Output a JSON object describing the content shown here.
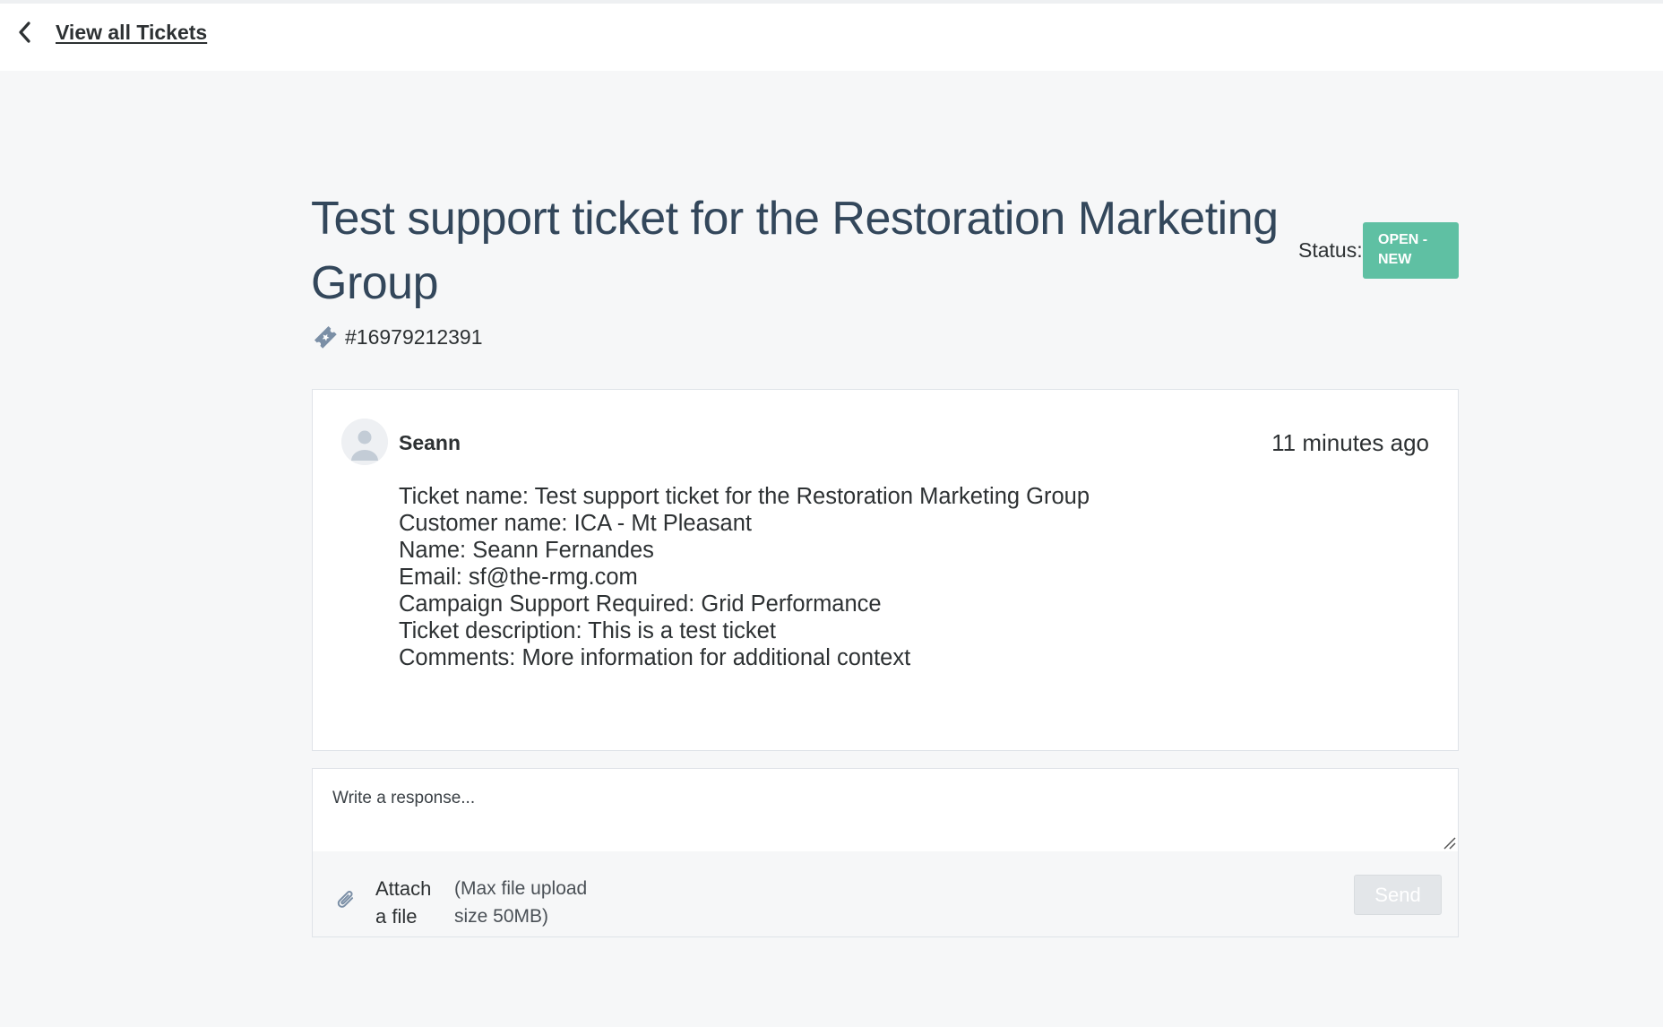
{
  "nav": {
    "back_label": "View all Tickets",
    "back_icon": "chevron-left-icon"
  },
  "ticket": {
    "title": "Test support ticket for the Restoration Marketing Group",
    "id": "#16979212391",
    "id_icon": "ticket-icon",
    "status_label": "Status:",
    "status_value": "OPEN - NEW",
    "status_color": "#5fc0a3"
  },
  "message": {
    "author": "Seann",
    "timestamp": "11 minutes ago",
    "avatar_icon": "user-avatar-icon",
    "lines": [
      "Ticket name: Test support ticket for the Restoration Marketing Group",
      "Customer name: ICA - Mt Pleasant",
      "Name: Seann Fernandes",
      "Email: sf@the-rmg.com",
      "Campaign Support Required: Grid Performance",
      "Ticket description: This is a test ticket",
      "Comments: More information for additional context"
    ]
  },
  "reply": {
    "placeholder": "Write a response...",
    "value": "",
    "attach_label": "Attach a file",
    "attach_icon": "paperclip-icon",
    "attach_hint": "(Max file upload size 50MB)",
    "send_label": "Send"
  }
}
